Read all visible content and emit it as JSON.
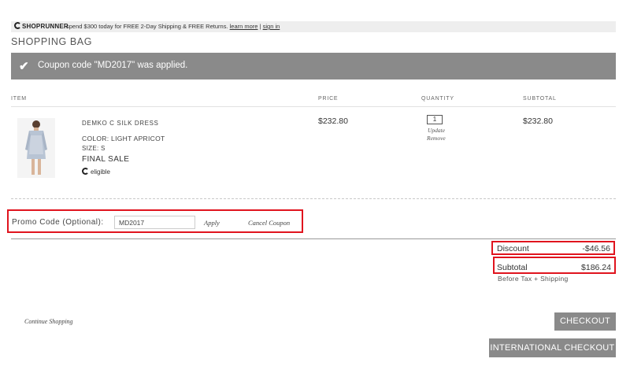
{
  "shoprunner": {
    "logo": "SHOPRUNNER",
    "promo": "spend $300 today for FREE 2-Day Shipping & FREE Returns.",
    "learn_more": "learn more",
    "separator": "|",
    "sign_in": "sign in"
  },
  "page_title": "SHOPPING BAG",
  "banner": {
    "check_icon": "✔",
    "message": "Coupon code \"MD2017\" was applied."
  },
  "table": {
    "headers": {
      "item": "ITEM",
      "price": "PRICE",
      "quantity": "QUANTITY",
      "subtotal": "SUBTOTAL"
    }
  },
  "product": {
    "name": "DEMKO C SILK DRESS",
    "color": "COLOR: LIGHT APRICOT",
    "size": "SIZE: S",
    "final_sale": "FINAL SALE",
    "eligible": "eligible",
    "price": "$232.80",
    "quantity": "1",
    "update": "Update",
    "remove": "Remove",
    "subtotal": "$232.80"
  },
  "promo": {
    "label": "Promo Code (Optional):",
    "value": "MD2017",
    "apply": "Apply",
    "cancel": "Cancel Coupon"
  },
  "totals": {
    "discount_label": "Discount",
    "discount_value": "-$46.56",
    "subtotal_label": "Subtotal",
    "subtotal_value": "$186.24",
    "note": "Before Tax + Shipping"
  },
  "continue_shopping": "Continue Shopping",
  "buttons": {
    "checkout": "CHECKOUT",
    "international_checkout": "INTERNATIONAL CHECKOUT"
  },
  "colors": {
    "banner": "#8a8a8a",
    "highlight": "#e0141e",
    "button": "#8a8a8a"
  }
}
